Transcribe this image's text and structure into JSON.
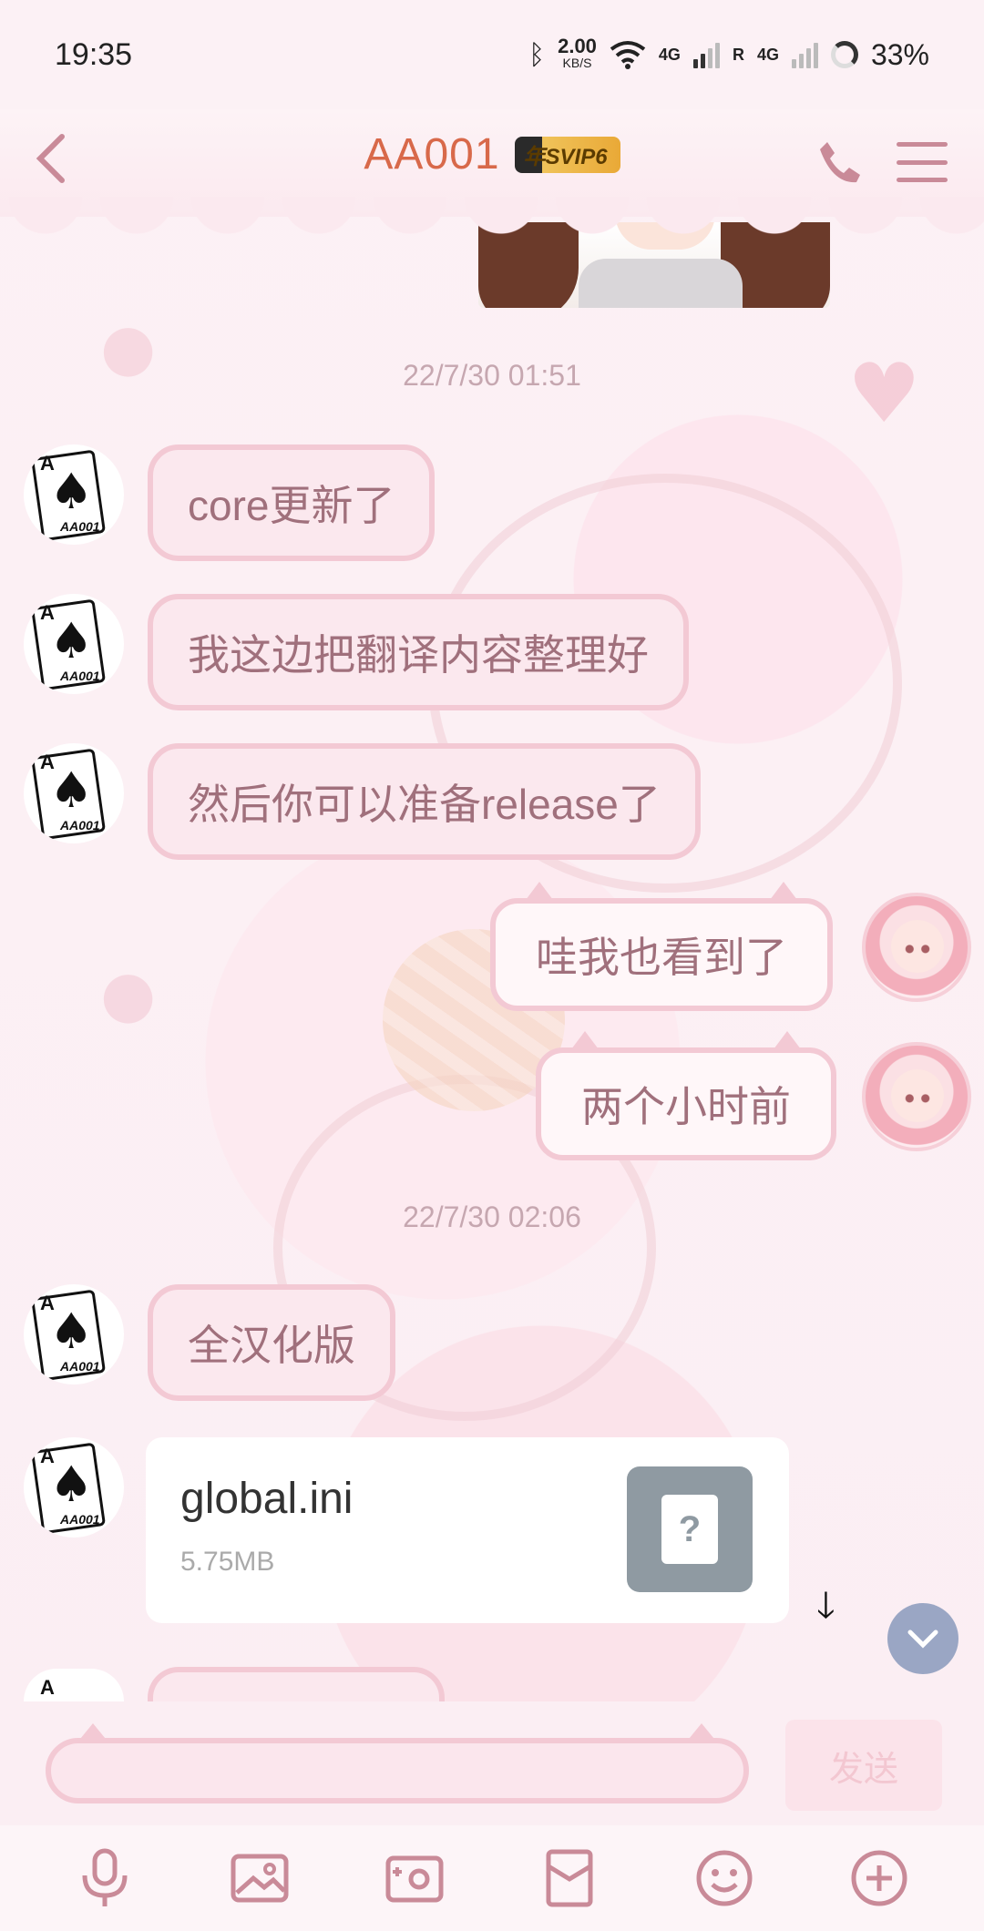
{
  "status_bar": {
    "time": "19:35",
    "net_speed_value": "2.00",
    "net_speed_unit": "KB/S",
    "net_type_1": "4G",
    "net_type_2": "4G",
    "roaming": "R",
    "battery": "33%"
  },
  "header": {
    "title": "AA001",
    "badge": "年SVIP6"
  },
  "messages": {
    "timestamp_1": "22/7/30 01:51",
    "m1": "core更新了",
    "m2": "我这边把翻译内容整理好",
    "m3": "然后你可以准备release了",
    "m4": "哇我也看到了",
    "m5": "两个小时前",
    "timestamp_2": "22/7/30 02:06",
    "m6": "全汉化版",
    "file_name": "global.ini",
    "file_size": "5.75MB"
  },
  "input": {
    "placeholder": "",
    "send_label": "发送"
  },
  "icons": {
    "back": "chevron-left-icon",
    "call": "phone-icon",
    "menu": "menu-icon",
    "voice": "microphone-icon",
    "image": "image-icon",
    "camera": "camera-icon",
    "red_packet": "red-packet-icon",
    "emoji": "emoji-icon",
    "more": "plus-circle-icon",
    "download": "download-arrow-icon",
    "scroll_down": "chevron-down-icon"
  },
  "colors": {
    "title": "#d8694a",
    "bubble_border": "#f3c9d4",
    "icon_tint": "#c98a98"
  }
}
